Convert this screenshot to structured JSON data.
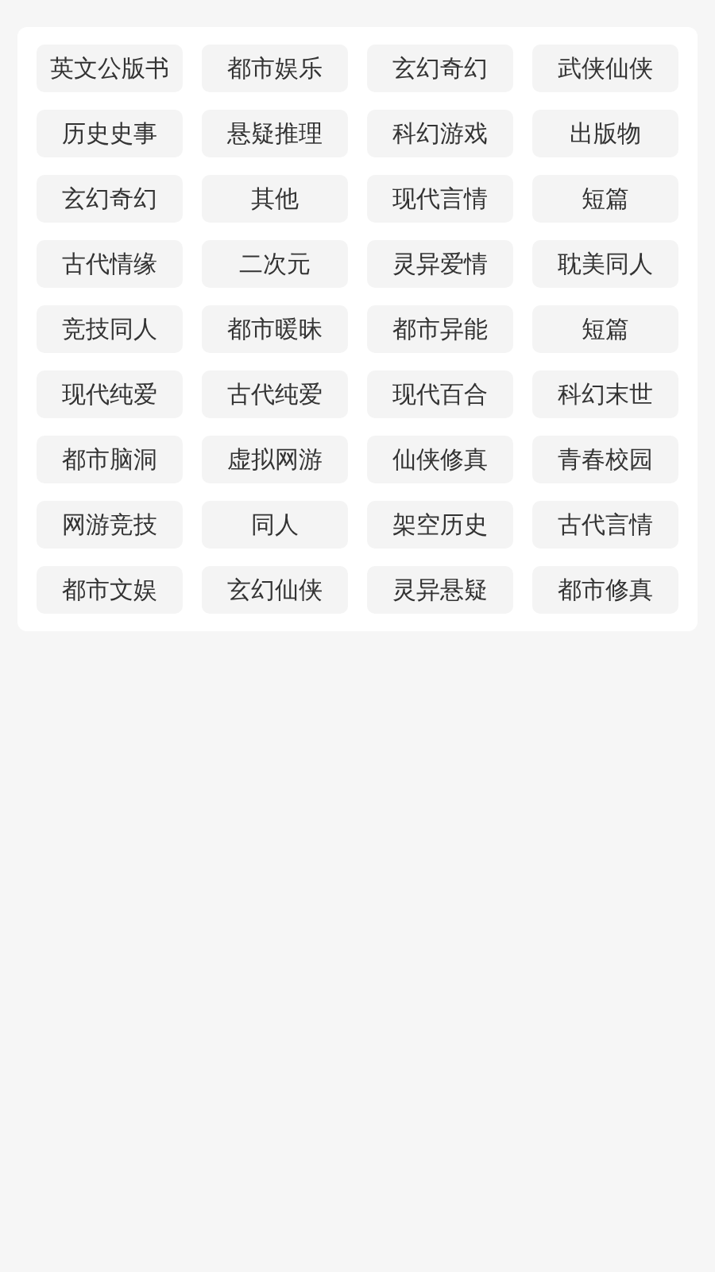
{
  "tags": [
    {
      "label": "英文公版书"
    },
    {
      "label": "都市娱乐"
    },
    {
      "label": "玄幻奇幻"
    },
    {
      "label": "武侠仙侠"
    },
    {
      "label": "历史史事"
    },
    {
      "label": "悬疑推理"
    },
    {
      "label": "科幻游戏"
    },
    {
      "label": "出版物"
    },
    {
      "label": "玄幻奇幻"
    },
    {
      "label": "其他"
    },
    {
      "label": "现代言情"
    },
    {
      "label": "短篇"
    },
    {
      "label": "古代情缘"
    },
    {
      "label": "二次元"
    },
    {
      "label": "灵异爱情"
    },
    {
      "label": "耽美同人"
    },
    {
      "label": "竞技同人"
    },
    {
      "label": "都市暖昧"
    },
    {
      "label": "都市异能"
    },
    {
      "label": "短篇"
    },
    {
      "label": "现代纯爱"
    },
    {
      "label": "古代纯爱"
    },
    {
      "label": "现代百合"
    },
    {
      "label": "科幻末世"
    },
    {
      "label": "都市脑洞"
    },
    {
      "label": "虚拟网游"
    },
    {
      "label": "仙侠修真"
    },
    {
      "label": "青春校园"
    },
    {
      "label": "网游竞技"
    },
    {
      "label": "同人"
    },
    {
      "label": "架空历史"
    },
    {
      "label": "古代言情"
    },
    {
      "label": "都市文娱"
    },
    {
      "label": "玄幻仙侠"
    },
    {
      "label": "灵异悬疑"
    },
    {
      "label": "都市修真"
    }
  ]
}
